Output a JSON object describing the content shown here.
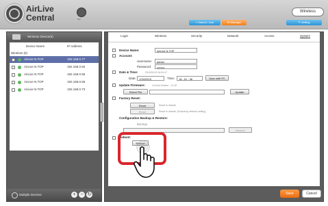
{
  "header": {
    "brand_line1": "AirLive",
    "brand_line2": "Central",
    "exit_label": "Exit",
    "mode_button": "Wireless",
    "search_add": "Search / Add",
    "manager": "Manager",
    "setting": "Setting"
  },
  "left_panel": {
    "title": "Wireless Device(5)",
    "columns": [
      "Device Name",
      "IP Address"
    ],
    "group": "Wireless (5)",
    "devices": [
      {
        "name": "AirLive N.TOP",
        "ip": "192.168.0.77",
        "selected": true
      },
      {
        "name": "AirLive N.TOP",
        "ip": "192.168.0.92",
        "selected": false
      },
      {
        "name": "AirLive N.TOP",
        "ip": "192.168.0.95",
        "selected": false
      },
      {
        "name": "AirLive N.TOP",
        "ip": "192.168.0.56",
        "selected": false
      },
      {
        "name": "AirLive N.TOP",
        "ip": "192.168.0.73",
        "selected": false
      }
    ],
    "bottom_label": "Multiple Devices",
    "add": "+",
    "remove": "−",
    "refresh": "↻"
  },
  "tabs": [
    "Login",
    "Wireless",
    "Security",
    "Network",
    "Access",
    "System"
  ],
  "system": {
    "device_name_label": "Device Name:",
    "device_name_value": "AirLive N.TOP",
    "account_label": "Account:",
    "username_label": "Username:",
    "username_value": "admin",
    "password_label": "Password:",
    "password_value": "••••••••",
    "datetime_label": "Date & Time:",
    "datetime_current": "2015/01/15 18:51:47",
    "date_label": "Date:",
    "date_value": "1/15/2015",
    "time_label": "Time:",
    "time_value": "18 : 51 : 36",
    "sync_button": "Sync with PC",
    "firmware_label": "Update Firmware:",
    "firmware_current": "Current Version : V1.20",
    "select_file": "Select File",
    "update": "Update",
    "factory_label": "Factory Reset:",
    "reset": "Reset",
    "reset_hint1": "Reset to default.",
    "reset_hint2": "Reset to default. (Excluding network setting)",
    "config_label": "Configuration Backup & Restore:",
    "backup": "Backup",
    "restore": "Restore",
    "reboot_label": "Reboot:",
    "reboot": "Reboot"
  },
  "actions": {
    "save": "Save",
    "cancel": "Cancel"
  },
  "colors": {
    "accent_orange": "#f07f1a",
    "accent_blue": "#2d95d6",
    "highlight": "#d9262c"
  }
}
